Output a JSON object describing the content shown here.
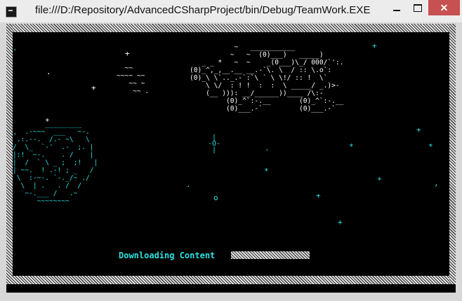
{
  "window": {
    "title": "file:///D:/Repository/AdvancedCSharpProject/bin/Debug/TeamWork.EXE",
    "minimize_label": "",
    "maximize_label": "",
    "close_label": "✕"
  },
  "console": {
    "ascii_ship": "           ~   ___________\n          ~   ~  (0)___)   _____)\n   _ _ *   ~  ~    _(0___)\\_/ 000/`':.\n(0)_^,_,__.__ __.-`\\. \\  / :: \\.o`:\n(0)_\\ \\`.._.-`:`\\ ` \\ \\!/ :: !  \\`\n    \\ \\/  : ! !  :  :  \\ _____/ _.)>-\n    (__ ))): __/______))____ /\\:-\n         (0)_^`:-.__       (0)_^`:-.__\n         (0)___.-`         (0)___.-`",
    "ascii_waves": "  ~~\n~~~~ ~~\n   ~~ ~\n    ~~ .",
    "ascii_planet": "        _________\n   .-~~~  ___   ~-.\n .:.--.  /.- ~\\   \\\n/  \\_  `-'  .-  ;. |\n|:!  ~-.    . /    |\n|  /  ` \\ _ ;  ;!   |\n| ~~.  ! .-! ; _   /\n \\  :-~-. `-._/~ ./\n  \\  | .   . /  /\n   ~-.___ /   .~\n      ~~~~~~~~",
    "crosshair": " |\n-O-\n |",
    "loading_label": "Downloading Content",
    "progress_fraction": 1.0
  }
}
